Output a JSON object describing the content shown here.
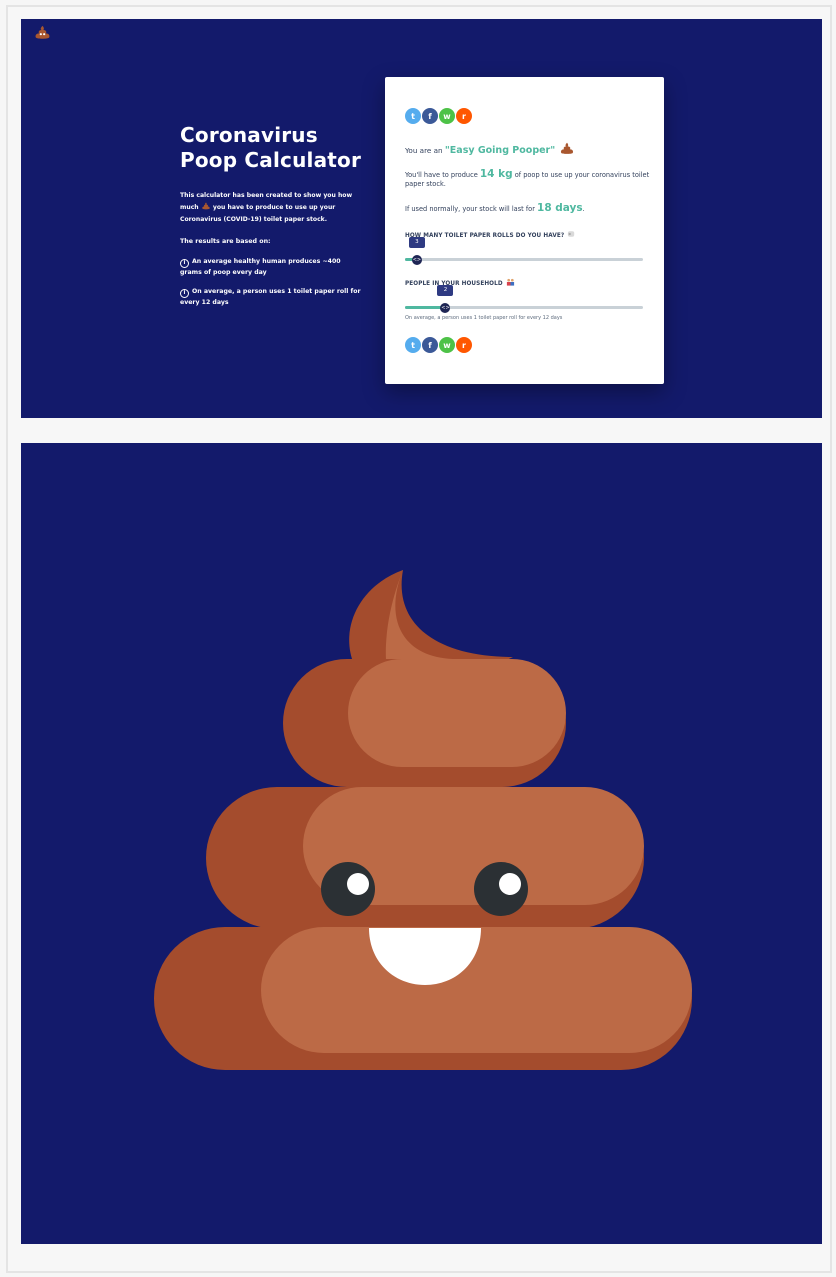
{
  "app": {
    "title_line1": "Coronavirus",
    "title_line2": "Poop Calculator",
    "intro_before": "This calculator has been created to show you how much",
    "intro_after": "you have to produce to use up your Coronavirus (COVID-19) toilet paper stock.",
    "based_on": "The results are based on:",
    "facts": [
      "An average healthy human produces ~400 grams of poop every day",
      "On average, a person uses 1 toilet paper roll for every 12 days"
    ],
    "info_glyph": "i"
  },
  "result": {
    "prefix": "You are an",
    "rank": "\"Easy Going Pooper\"",
    "produce_prefix": "You'll have to produce",
    "produce_value": "14 kg",
    "produce_suffix": "of poop to use up your coronavirus toilet paper stock.",
    "last_prefix": "If used normally, your stock will last for",
    "last_value": "18 days",
    "last_suffix": "."
  },
  "sliders": {
    "rolls": {
      "label": "HOW MANY TOILET PAPER ROLLS DO YOU HAVE?",
      "value": "3",
      "fraction": 0.05
    },
    "people": {
      "label": "PEOPLE IN YOUR HOUSEHOLD",
      "value": "2",
      "fraction": 0.17
    },
    "thumb_glyph": "<>",
    "note": "On average, a person uses 1 toilet paper roll for every 12 days"
  },
  "share": {
    "twitter": "t",
    "facebook": "f",
    "whatsapp": "w",
    "reddit": "r"
  },
  "colors": {
    "background": "#131a6b",
    "accent": "#4fb8a0",
    "poop_light": "#bc6a46",
    "poop_dark": "#a44c2d"
  },
  "icons": {
    "logo": "poop-emoji-icon",
    "hero": "poop-emoji-illustration"
  }
}
